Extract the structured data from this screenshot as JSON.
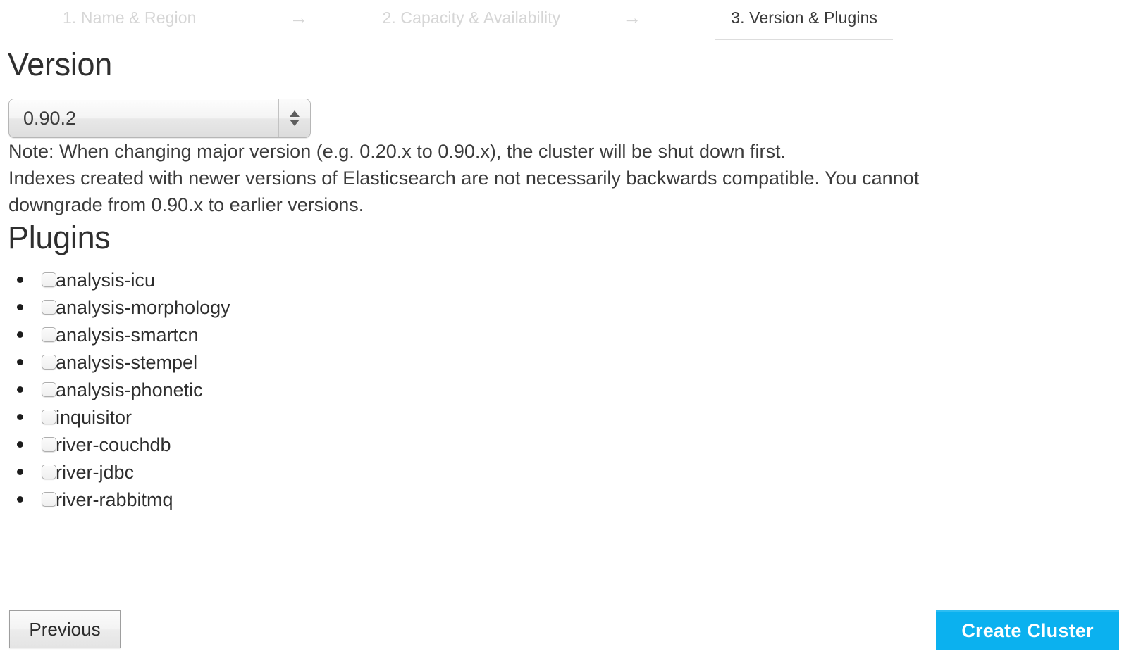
{
  "wizard": {
    "steps": [
      {
        "label": "1. Name & Region",
        "state": "inactive"
      },
      {
        "label": "2. Capacity & Availability",
        "state": "inactive"
      },
      {
        "label": "3. Version & Plugins",
        "state": "active"
      }
    ],
    "arrow_glyph": "→"
  },
  "version": {
    "heading": "Version",
    "selected": "0.90.2",
    "note_1": "Note: When changing major version (e.g. 0.20.x to 0.90.x), the cluster will be shut down first.",
    "note_2": "Indexes created with newer versions of Elasticsearch are not necessarily backwards compatible. You cannot downgrade from 0.90.x to earlier versions."
  },
  "plugins": {
    "heading": "Plugins",
    "items": [
      {
        "label": "analysis-icu",
        "checked": false
      },
      {
        "label": "analysis-morphology",
        "checked": false
      },
      {
        "label": "analysis-smartcn",
        "checked": false
      },
      {
        "label": "analysis-stempel",
        "checked": false
      },
      {
        "label": "analysis-phonetic",
        "checked": false
      },
      {
        "label": "inquisitor",
        "checked": false
      },
      {
        "label": "river-couchdb",
        "checked": false
      },
      {
        "label": "river-jdbc",
        "checked": false
      },
      {
        "label": "river-rabbitmq",
        "checked": false
      }
    ]
  },
  "footer": {
    "previous_label": "Previous",
    "create_label": "Create Cluster",
    "create_color": "#0bb1ef"
  }
}
